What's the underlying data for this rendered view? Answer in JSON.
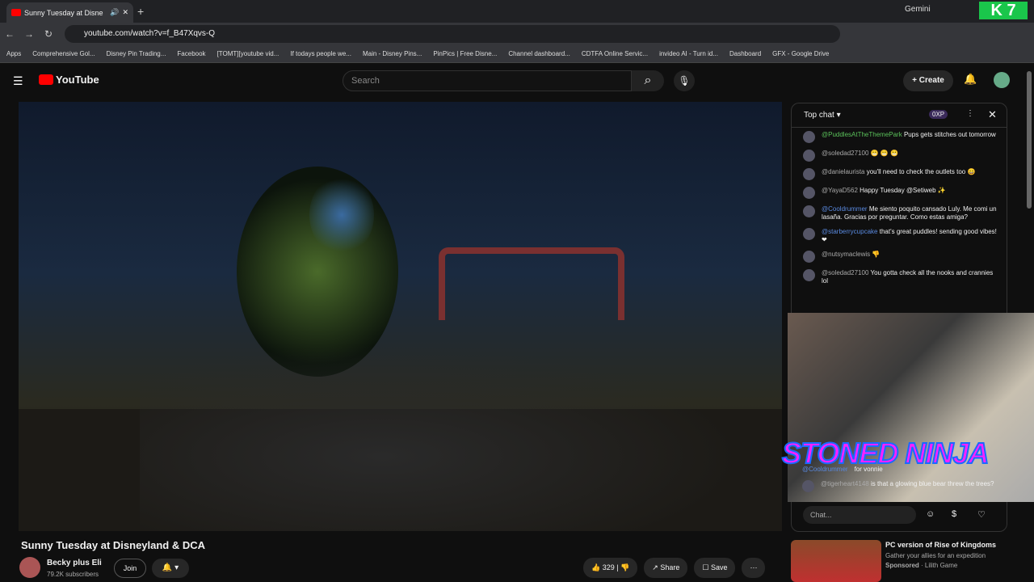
{
  "browser": {
    "tab_title": "Sunny Tuesday at Disne",
    "url": "youtube.com/watch?v=f_B47Xqvs-Q",
    "gemini": "Gemini",
    "bookmarks": [
      "Apps",
      "Comprehensive Gol...",
      "Disney Pin Trading...",
      "Facebook",
      "[TOMT][youtube vid...",
      "If todays people we...",
      "Main - Disney Pins...",
      "PinPics | Free Disne...",
      "Channel dashboard...",
      "CDTFA Online Servic...",
      "invideo AI - Turn id...",
      "Dashboard",
      "GFX - Google Drive"
    ]
  },
  "header": {
    "logo": "YouTube",
    "search_placeholder": "Search",
    "create": "Create"
  },
  "video": {
    "title": "Sunny Tuesday at Disneyland & DCA",
    "channel": "Becky plus Eli",
    "subscribers": "79.2K subscribers",
    "join": "Join",
    "likes": "329",
    "share": "Share",
    "save": "Save"
  },
  "chat": {
    "header": "Top chat",
    "xp": "0XP",
    "messages": [
      {
        "author": "@PuddlesAtTheThemePark",
        "text": "Pups gets stitches out tomorrow",
        "color": "g"
      },
      {
        "author": "@soledad27100",
        "text": "😬 😬 😬",
        "color": ""
      },
      {
        "author": "@danielaurista",
        "text": "you'll need to check the outlets too 😄",
        "color": ""
      },
      {
        "author": "@YayaD562",
        "text": "Happy Tuesday @Setiweb ✨",
        "color": ""
      },
      {
        "author": "@Cooldrummer",
        "text": "Me siento poquito cansado Luly. Me comi un lasaña. Gracias por preguntar. Como estas amiga?",
        "color": "b"
      },
      {
        "author": "@starberrycupcake",
        "text": "that's great puddles! sending good vibes! ❤",
        "color": "b"
      },
      {
        "author": "@nutsymaclewis",
        "text": "👎",
        "color": ""
      },
      {
        "author": "@soledad27100",
        "text": "You gotta check all the nooks and crannies lol",
        "color": ""
      }
    ],
    "partial": "@Cooldrummer",
    "partial_text": "for vonnie",
    "last_author": "@tigerheart4148",
    "last_text": "is that a glowing blue bear threw the trees?",
    "input_placeholder": "Chat..."
  },
  "overlay": {
    "ninja": "STONED NINJA"
  },
  "recommendation": {
    "title": "PC version of Rise of Kingdoms",
    "subtitle": "Gather your allies for an expedition",
    "sponsored": "Sponsored",
    "sponsor": "Lilith Game"
  }
}
